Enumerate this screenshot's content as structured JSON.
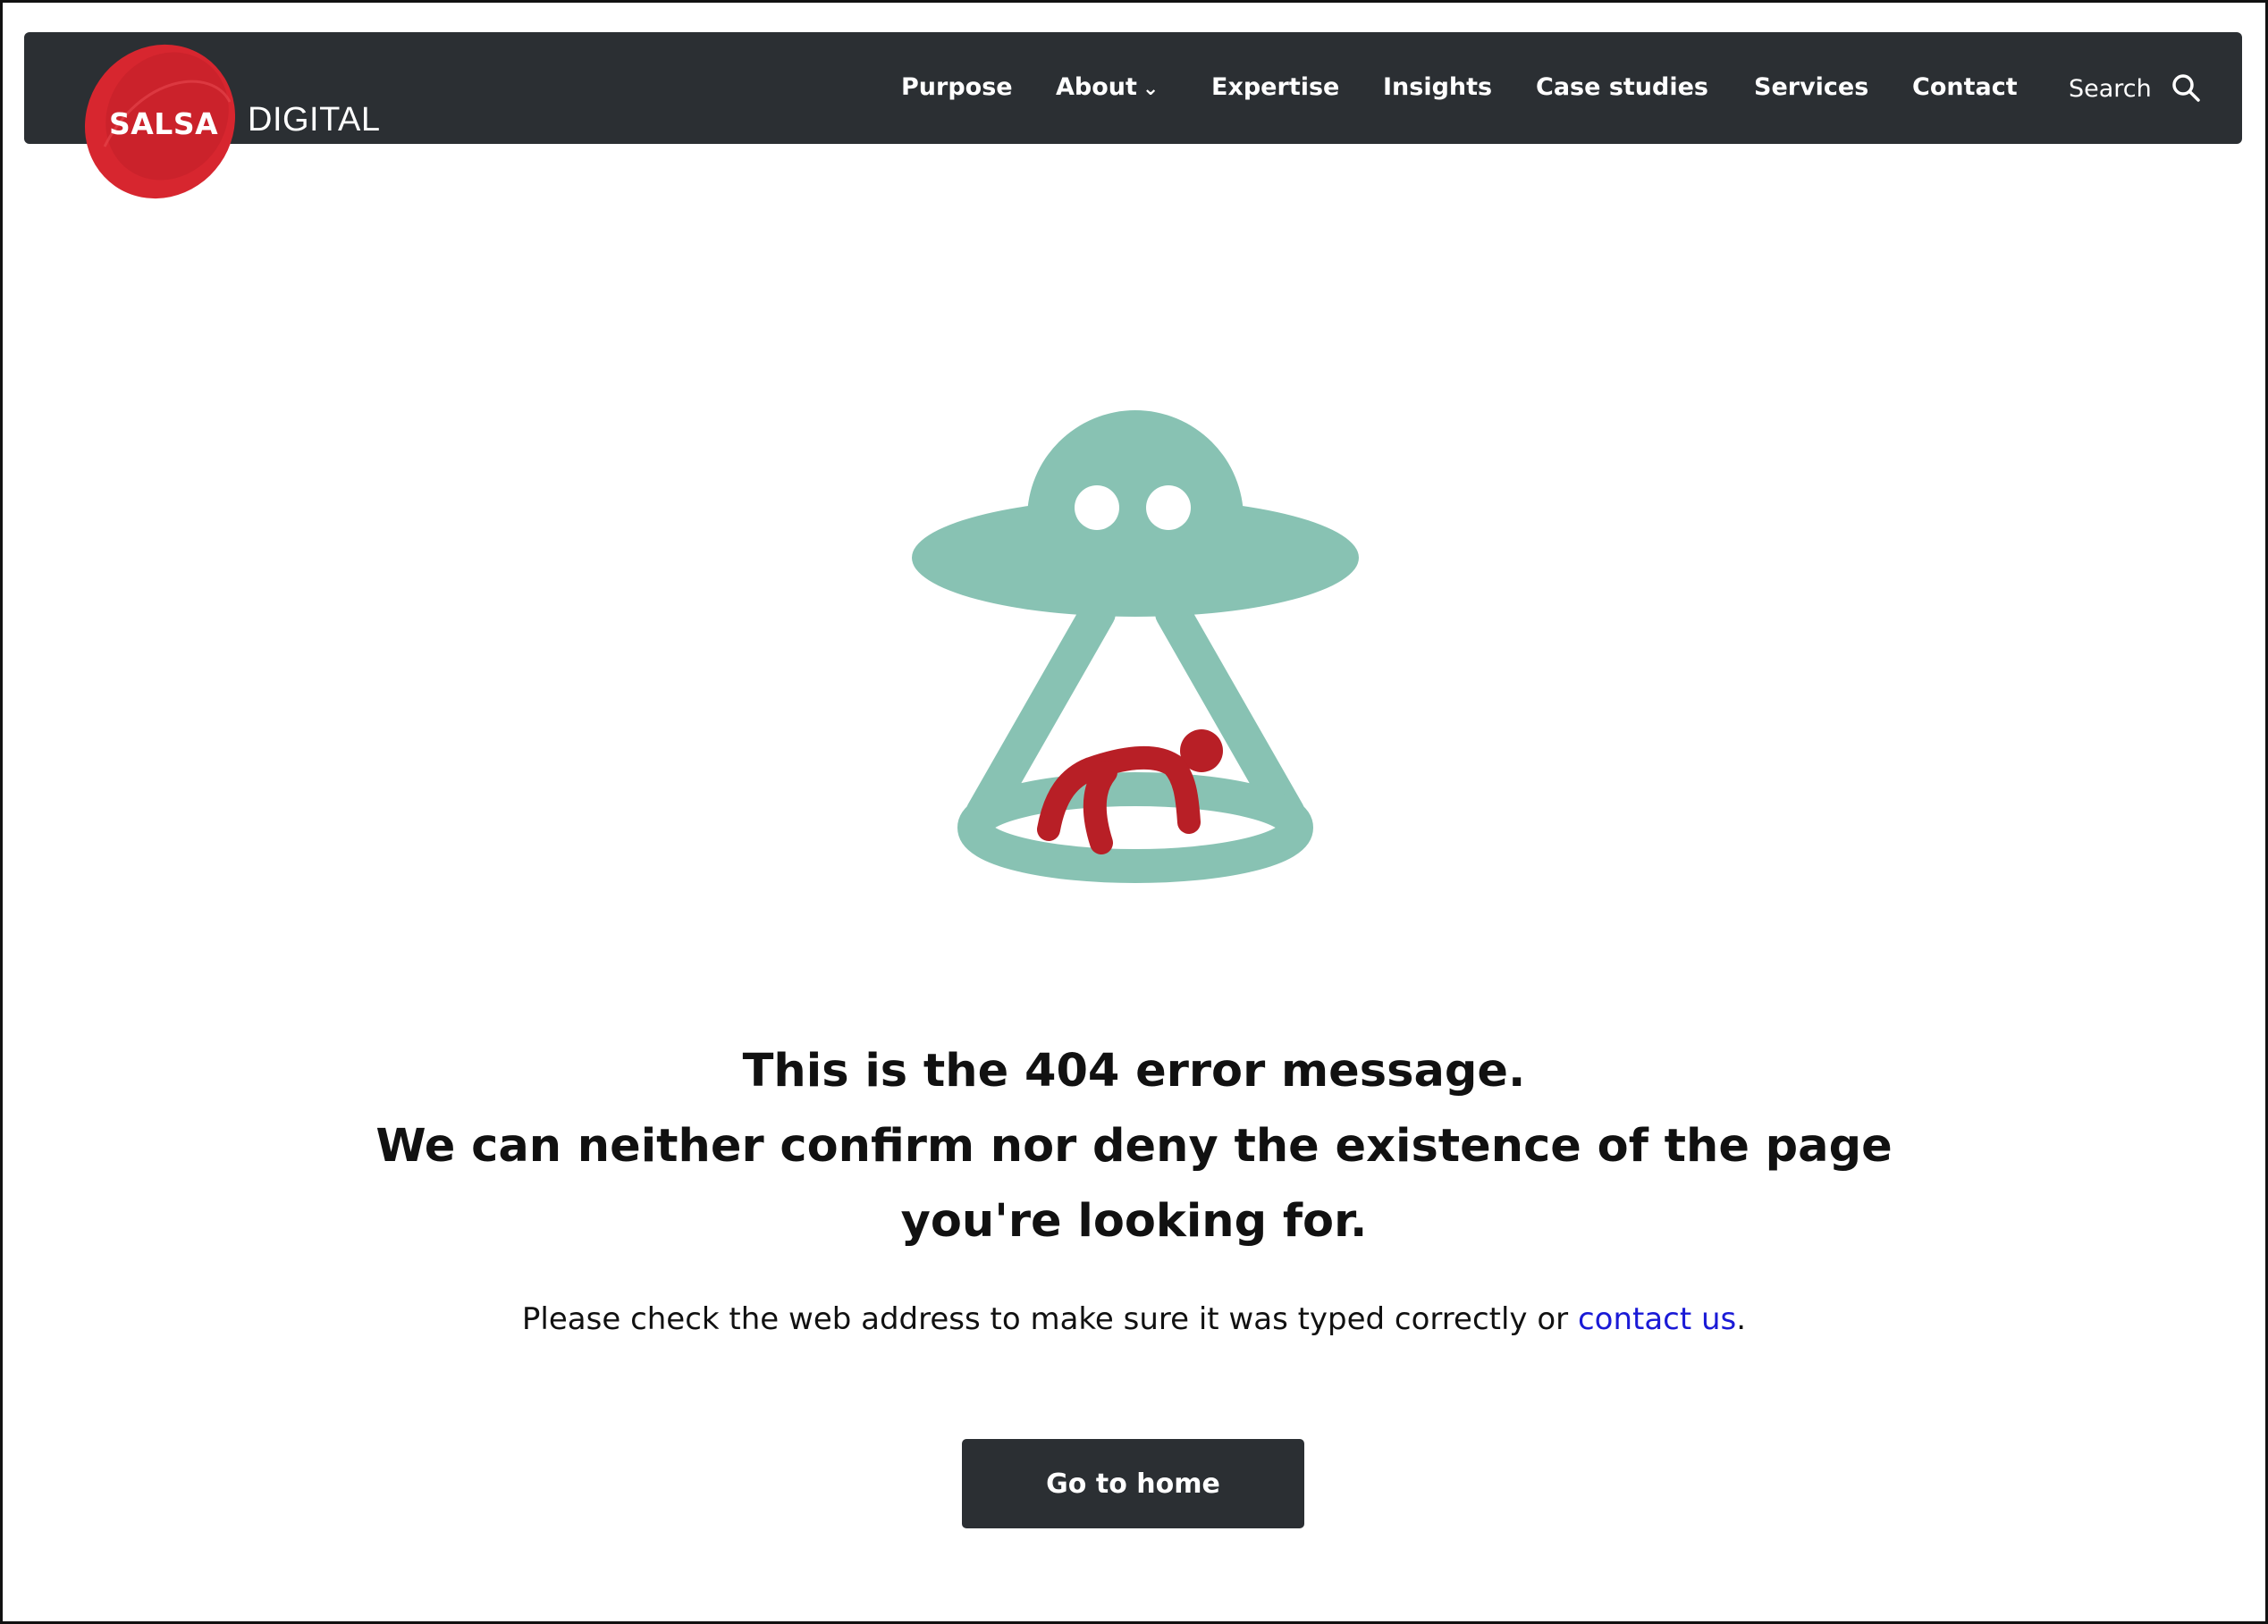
{
  "brand": {
    "logo_word": "SALSA",
    "logo_suffix": "DIGITAL",
    "color_red": "#d7262f",
    "color_dark": "#2b2f33"
  },
  "nav": {
    "items": [
      {
        "label": "Purpose"
      },
      {
        "label": "About",
        "has_dropdown": true
      },
      {
        "label": "Expertise"
      },
      {
        "label": "Insights"
      },
      {
        "label": "Case studies"
      },
      {
        "label": "Services"
      },
      {
        "label": "Contact"
      }
    ],
    "search_label": "Search",
    "dropdown_icon": "chevron-down-icon",
    "search_icon": "search-icon"
  },
  "illustration": {
    "icon": "ufo-abduction-icon",
    "ufo_color": "#88c2b3",
    "person_color": "#b81f26"
  },
  "error": {
    "line1": "This is the 404 error message.",
    "line2": "We can neither confirm nor deny the existence of the page",
    "line3": "you're looking for.",
    "note_before": "Please check the web address to make sure it was typed correctly or ",
    "note_link": "contact us",
    "note_after": ".",
    "link_color": "#1a1ad6"
  },
  "actions": {
    "home_label": "Go to home"
  }
}
